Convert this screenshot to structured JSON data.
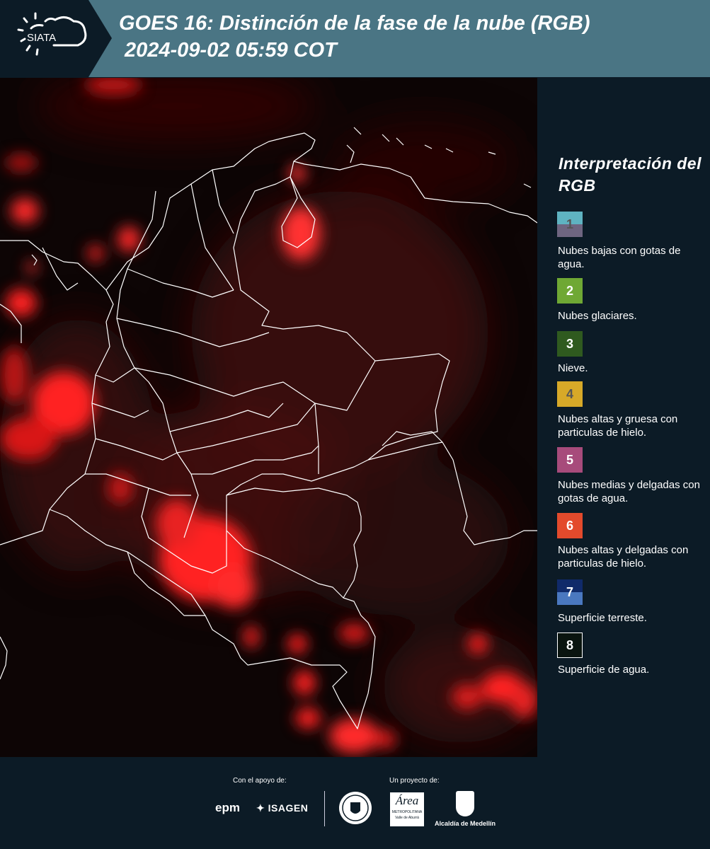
{
  "header": {
    "logo_text": "SIATA",
    "title_line1": "GOES 16: Distinción de la fase de la nube (RGB)",
    "title_line2": "2024-09-02 05:59 COT",
    "background_color": "#4a7584"
  },
  "legend": {
    "title": "Interpretación del RGB",
    "items": [
      {
        "number": "1",
        "label": "Nubes bajas con gotas de agua.",
        "color_top": "#5fb3c1",
        "color_bottom": "#6e6580",
        "number_color": "#555555"
      },
      {
        "number": "2",
        "label": "Nubes glaciares.",
        "color": "#6fa834",
        "number_color": "#ffffff"
      },
      {
        "number": "3",
        "label": "Nieve.",
        "color": "#2f5a1f",
        "number_color": "#ffffff"
      },
      {
        "number": "4",
        "label": "Nubes altas y gruesa con particulas de hielo.",
        "color": "#d7a928",
        "number_color": "#555555"
      },
      {
        "number": "5",
        "label": "Nubes medias y delgadas con gotas de agua.",
        "color": "#a74b7b",
        "number_color": "#ffffff"
      },
      {
        "number": "6",
        "label": "Nubes altas y delgadas con particulas de hielo.",
        "color": "#e34a2c",
        "number_color": "#ffffff"
      },
      {
        "number": "7",
        "label": "Superficie terreste.",
        "color_top": "#102a6a",
        "color_bottom": "#4a78c0",
        "number_color": "#ffffff"
      },
      {
        "number": "8",
        "label": "Superficie de agua.",
        "color": "#0a140f",
        "number_color": "#ffffff"
      }
    ]
  },
  "footer": {
    "support_label": "Con el apoyo de:",
    "project_label": "Un proyecto de:",
    "sponsor1": "epm",
    "sponsor2": "ISAGEN",
    "partner_area_line1": "Área",
    "partner_area_line2": "METROPOLITANA",
    "partner_area_line3": "Valle de Aburrá",
    "partner_alcaldia": "Alcaldía de Medellín"
  }
}
